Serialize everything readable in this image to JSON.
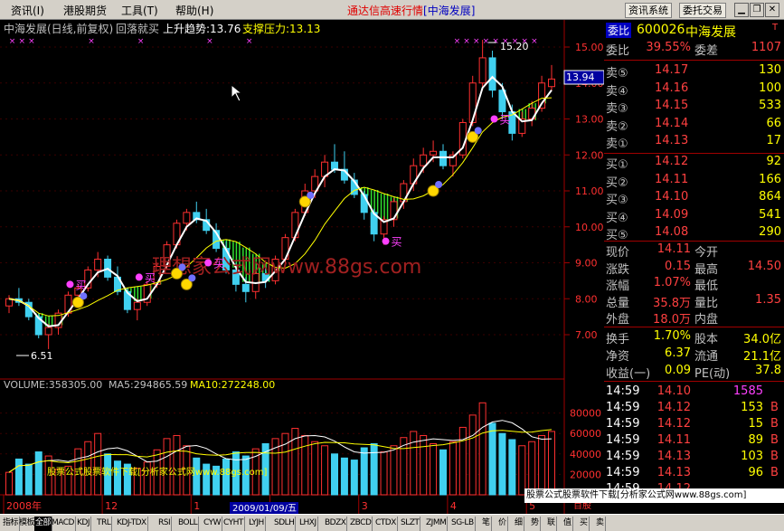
{
  "menu": {
    "items": [
      "资讯(I)",
      "港股期货",
      "工具(T)",
      "帮助(H)"
    ]
  },
  "app_title": {
    "name": "通达信高速行情",
    "stock": "[中海发展]"
  },
  "toolbar": {
    "news_btn": "资讯系统",
    "trade_btn": "委托交易"
  },
  "window_buttons": [
    "minimize-icon",
    "restore-icon",
    "close-icon"
  ],
  "chart_header": {
    "name": "中海发展(日线,前复权)",
    "formula": "回落就买",
    "trend_label": "上升趋势:13.76",
    "support_label": "支撑压力:13.13"
  },
  "price_axis": {
    "ticks": [
      "15.00",
      "14.00",
      "13.00",
      "12.00",
      "11.00",
      "10.00",
      "9.00",
      "8.00",
      "7.00"
    ],
    "current_tag": "13.94"
  },
  "annotations": {
    "high": "15.20",
    "low": "6.51",
    "buy": "买"
  },
  "volume_header": {
    "volume": "VOLUME:358305.00",
    "ma5": "MA5:294865.59",
    "ma10": "MA10:272248.00"
  },
  "volume_axis": {
    "ticks": [
      "80000",
      "60000",
      "40000",
      "20000"
    ],
    "unit": "百股"
  },
  "date_axis": {
    "labels": [
      "2008年",
      "12",
      "1",
      "2",
      "3",
      "4",
      "5"
    ],
    "cursor_date": "2009/01/09/五"
  },
  "watermarks": {
    "main": "理想家公式网www.88gs.com",
    "volume": "股票公式股票软件下载[分析家公式网www.88gs.com]",
    "banner": "股票公式股票软件下载[分析家公式网www.88gs.com]"
  },
  "quote": {
    "code": "600026",
    "name": "中海发展",
    "wb_label": "委比",
    "wb_value": "39.55%",
    "wc_label": "委差",
    "wc_value": "1107",
    "asks": [
      {
        "label": "卖⑤",
        "price": "14.17",
        "vol": "130"
      },
      {
        "label": "卖④",
        "price": "14.16",
        "vol": "100"
      },
      {
        "label": "卖③",
        "price": "14.15",
        "vol": "533"
      },
      {
        "label": "卖②",
        "price": "14.14",
        "vol": "66"
      },
      {
        "label": "卖①",
        "price": "14.13",
        "vol": "17"
      }
    ],
    "bids": [
      {
        "label": "买①",
        "price": "14.12",
        "vol": "92"
      },
      {
        "label": "买②",
        "price": "14.11",
        "vol": "166"
      },
      {
        "label": "买③",
        "price": "14.10",
        "vol": "864"
      },
      {
        "label": "买④",
        "price": "14.09",
        "vol": "541"
      },
      {
        "label": "买⑤",
        "price": "14.08",
        "vol": "290"
      }
    ],
    "stats": [
      {
        "l1": "现价",
        "v1": "14.11",
        "l2": "今开",
        "v2": ""
      },
      {
        "l1": "涨跌",
        "v1": "0.15",
        "l2": "最高",
        "v2": "14.50"
      },
      {
        "l1": "涨幅",
        "v1": "1.07%",
        "l2": "最低",
        "v2": ""
      },
      {
        "l1": "总量",
        "v1": "35.8万",
        "l2": "量比",
        "v2": "1.35"
      },
      {
        "l1": "外盘",
        "v1": "18.0万",
        "l2": "内盘",
        "v2": ""
      }
    ],
    "fundamentals": [
      {
        "l1": "换手",
        "v1": "1.70%",
        "l2": "股本",
        "v2": "34.0亿"
      },
      {
        "l1": "净资",
        "v1": "6.37",
        "l2": "流通",
        "v2": "21.1亿"
      },
      {
        "l1": "收益(一)",
        "v1": "0.09",
        "l2": "PE(动)",
        "v2": "37.8"
      }
    ],
    "ticks": [
      {
        "time": "14:59",
        "price": "14.10",
        "vol": "1585",
        "side": ""
      },
      {
        "time": "14:59",
        "price": "14.12",
        "vol": "153",
        "side": "B"
      },
      {
        "time": "14:59",
        "price": "14.12",
        "vol": "15",
        "side": "B"
      },
      {
        "time": "14:59",
        "price": "14.11",
        "vol": "89",
        "side": "B"
      },
      {
        "time": "14:59",
        "price": "14.13",
        "vol": "103",
        "side": "B"
      },
      {
        "time": "14:59",
        "price": "14.13",
        "vol": "96",
        "side": "B"
      },
      {
        "time": "14:59",
        "price": "14.12",
        "vol": "",
        "side": ""
      }
    ]
  },
  "bottom_tabs": [
    "指标",
    "模板",
    "全部",
    "MACD",
    "KDJ",
    "TRL",
    "KDJ-TDX",
    "RSI",
    "BOLL",
    "CYW",
    "CYHT",
    "LYJH",
    "SDLH",
    "LHXJ",
    "BDZX",
    "ZBCD",
    "CTDX",
    "SLZT",
    "ZJMM",
    "SG-LB",
    "笔",
    "价",
    "细",
    "势",
    "联",
    "值",
    "买",
    "卖"
  ],
  "chart_data": {
    "type": "candlestick",
    "title": "中海发展(日线,前复权)",
    "xlabels": [
      "2008年",
      "12",
      "1",
      "2",
      "3",
      "4",
      "5"
    ],
    "y_ticks": [
      7,
      8,
      9,
      10,
      11,
      12,
      13,
      14,
      15
    ],
    "ylim": [
      6.3,
      15.6
    ],
    "ohlc": [
      [
        7.8,
        8.1,
        7.6,
        8.0
      ],
      [
        8.0,
        8.3,
        7.8,
        7.9
      ],
      [
        7.9,
        8.0,
        7.4,
        7.5
      ],
      [
        7.5,
        7.6,
        6.9,
        7.0
      ],
      [
        7.0,
        7.3,
        6.6,
        7.2
      ],
      [
        7.2,
        7.7,
        7.0,
        7.6
      ],
      [
        7.6,
        8.2,
        7.5,
        8.1
      ],
      [
        8.1,
        8.4,
        7.9,
        8.3
      ],
      [
        8.3,
        8.9,
        8.2,
        8.8
      ],
      [
        8.8,
        9.3,
        8.6,
        9.1
      ],
      [
        9.1,
        9.2,
        8.5,
        8.6
      ],
      [
        8.6,
        8.9,
        8.1,
        8.2
      ],
      [
        8.2,
        8.3,
        7.6,
        7.7
      ],
      [
        7.7,
        8.0,
        7.4,
        7.9
      ],
      [
        7.9,
        8.5,
        7.8,
        8.4
      ],
      [
        8.4,
        9.0,
        8.3,
        8.9
      ],
      [
        8.9,
        9.6,
        8.8,
        9.5
      ],
      [
        9.5,
        10.2,
        9.4,
        10.1
      ],
      [
        10.1,
        10.5,
        9.9,
        10.4
      ],
      [
        10.4,
        10.7,
        10.1,
        10.2
      ],
      [
        10.2,
        10.5,
        9.8,
        9.9
      ],
      [
        9.9,
        10.1,
        9.3,
        9.4
      ],
      [
        9.4,
        9.6,
        8.7,
        8.8
      ],
      [
        8.8,
        9.0,
        8.2,
        8.4
      ],
      [
        8.4,
        8.6,
        7.9,
        8.2
      ],
      [
        8.2,
        8.8,
        8.0,
        8.7
      ],
      [
        8.7,
        8.9,
        8.3,
        8.5
      ],
      [
        8.5,
        9.2,
        8.4,
        9.1
      ],
      [
        9.1,
        9.8,
        9.0,
        9.7
      ],
      [
        9.7,
        10.5,
        9.6,
        10.4
      ],
      [
        10.4,
        11.2,
        10.3,
        11.0
      ],
      [
        11.0,
        11.6,
        10.8,
        11.4
      ],
      [
        11.4,
        12.0,
        11.1,
        11.8
      ],
      [
        11.8,
        12.3,
        11.5,
        11.6
      ],
      [
        11.6,
        12.1,
        11.2,
        11.3
      ],
      [
        11.3,
        11.5,
        10.8,
        10.9
      ],
      [
        10.9,
        11.0,
        10.2,
        10.4
      ],
      [
        10.4,
        10.5,
        9.6,
        9.8
      ],
      [
        9.8,
        10.3,
        9.5,
        10.2
      ],
      [
        10.2,
        10.8,
        10.0,
        10.7
      ],
      [
        10.7,
        11.3,
        10.5,
        11.2
      ],
      [
        11.2,
        11.9,
        11.0,
        11.7
      ],
      [
        11.7,
        12.2,
        11.5,
        12.0
      ],
      [
        12.0,
        12.4,
        11.8,
        12.1
      ],
      [
        12.1,
        12.3,
        11.6,
        11.7
      ],
      [
        11.7,
        12.1,
        11.4,
        12.0
      ],
      [
        12.0,
        13.0,
        11.9,
        12.9
      ],
      [
        12.9,
        14.2,
        12.8,
        14.0
      ],
      [
        14.0,
        15.2,
        13.8,
        14.7
      ],
      [
        14.7,
        14.9,
        13.6,
        13.8
      ],
      [
        13.8,
        14.0,
        13.0,
        13.2
      ],
      [
        13.2,
        13.4,
        12.4,
        12.6
      ],
      [
        12.6,
        13.2,
        12.5,
        13.0
      ],
      [
        13.0,
        13.5,
        12.8,
        13.3
      ],
      [
        13.3,
        14.2,
        13.2,
        14.0
      ],
      [
        13.9,
        14.5,
        13.8,
        14.11
      ]
    ],
    "volume": [
      22000,
      35000,
      30000,
      42000,
      38000,
      25000,
      28000,
      45000,
      52000,
      60000,
      40000,
      33000,
      30000,
      26000,
      32000,
      44000,
      55000,
      58000,
      48000,
      36000,
      30000,
      28000,
      35000,
      42000,
      38000,
      45000,
      50000,
      55000,
      60000,
      65000,
      58000,
      52000,
      48000,
      40000,
      36000,
      34000,
      46000,
      50000,
      42000,
      48000,
      56000,
      62000,
      58000,
      50000,
      44000,
      52000,
      66000,
      78000,
      90000,
      70000,
      60000,
      54000,
      48000,
      52000,
      58000,
      62000
    ],
    "volume_ylim": [
      0,
      100000
    ],
    "volume_ticks": [
      20000,
      40000,
      60000,
      80000
    ],
    "markers": {
      "high": 15.2,
      "low": 6.51
    }
  }
}
